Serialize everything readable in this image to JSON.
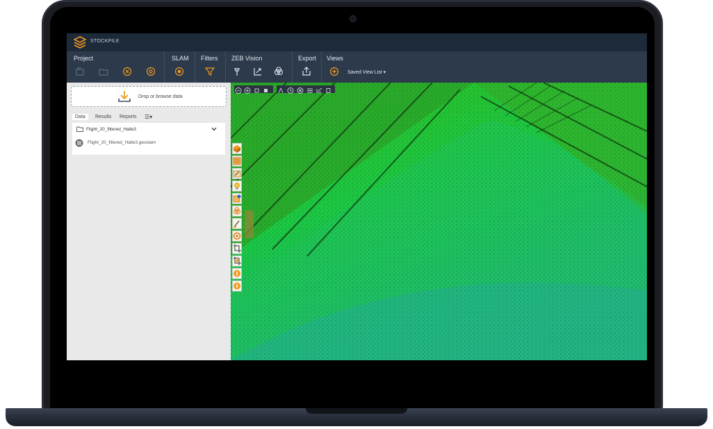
{
  "app": {
    "name": "STOCKPILE"
  },
  "ribbon": {
    "groups": [
      {
        "title": "Project"
      },
      {
        "title": "SLAM"
      },
      {
        "title": "Filters"
      },
      {
        "title": "ZEB Vision"
      },
      {
        "title": "Export"
      },
      {
        "title": "Views"
      }
    ],
    "saved_view": "Saved View List"
  },
  "left_panel": {
    "drop_label": "Drop or browse data",
    "tabs": [
      "Data",
      "Results",
      "Reports"
    ],
    "folder": "Flight_20_filtered_Halle3",
    "file": "Flight_20_filtered_Halle3.geoslam"
  },
  "colors": {
    "titlebar": "#1d2a3a",
    "ribbon": "#2c3a4c",
    "accent": "#f39a1f",
    "pointcloud_top": "#33b82a",
    "pointcloud_bottom": "#27a99a"
  }
}
